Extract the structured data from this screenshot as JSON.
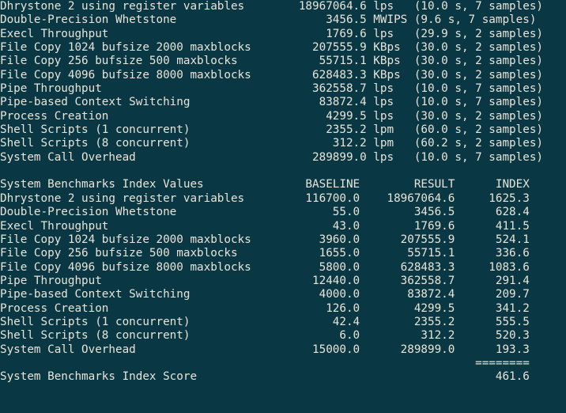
{
  "terminal": {
    "background_color": "#0a3744",
    "foreground_color": "#e8e4d8",
    "columns": 79,
    "rows": 30
  },
  "results": {
    "section_name": "benchmark-results",
    "rows": [
      {
        "name": "Dhrystone 2 using register variables",
        "value": "18967064.6",
        "unit": "lps",
        "timing": "(10.0 s, 7 samples)"
      },
      {
        "name": "Double-Precision Whetstone",
        "value": "3456.5",
        "unit": "MWIPS",
        "timing": "(9.6 s, 7 samples)"
      },
      {
        "name": "Execl Throughput",
        "value": "1769.6",
        "unit": "lps",
        "timing": "(29.9 s, 2 samples)"
      },
      {
        "name": "File Copy 1024 bufsize 2000 maxblocks",
        "value": "207555.9",
        "unit": "KBps",
        "timing": "(30.0 s, 2 samples)"
      },
      {
        "name": "File Copy 256 bufsize 500 maxblocks",
        "value": "55715.1",
        "unit": "KBps",
        "timing": "(30.0 s, 2 samples)"
      },
      {
        "name": "File Copy 4096 bufsize 8000 maxblocks",
        "value": "628483.3",
        "unit": "KBps",
        "timing": "(30.0 s, 2 samples)"
      },
      {
        "name": "Pipe Throughput",
        "value": "362558.7",
        "unit": "lps",
        "timing": "(10.0 s, 7 samples)"
      },
      {
        "name": "Pipe-based Context Switching",
        "value": "83872.4",
        "unit": "lps",
        "timing": "(10.0 s, 7 samples)"
      },
      {
        "name": "Process Creation",
        "value": "4299.5",
        "unit": "lps",
        "timing": "(30.0 s, 2 samples)"
      },
      {
        "name": "Shell Scripts (1 concurrent)",
        "value": "2355.2",
        "unit": "lpm",
        "timing": "(60.0 s, 2 samples)"
      },
      {
        "name": "Shell Scripts (8 concurrent)",
        "value": "312.2",
        "unit": "lpm",
        "timing": "(60.2 s, 2 samples)"
      },
      {
        "name": "System Call Overhead",
        "value": "289899.0",
        "unit": "lps",
        "timing": "(10.0 s, 7 samples)"
      }
    ]
  },
  "index_table": {
    "section_name": "system-benchmarks-index-values",
    "title": "System Benchmarks Index Values",
    "headers": {
      "baseline": "BASELINE",
      "result": "RESULT",
      "index": "INDEX"
    },
    "rows": [
      {
        "name": "Dhrystone 2 using register variables",
        "baseline": "116700.0",
        "result": "18967064.6",
        "index": "1625.3"
      },
      {
        "name": "Double-Precision Whetstone",
        "baseline": "55.0",
        "result": "3456.5",
        "index": "628.4"
      },
      {
        "name": "Execl Throughput",
        "baseline": "43.0",
        "result": "1769.6",
        "index": "411.5"
      },
      {
        "name": "File Copy 1024 bufsize 2000 maxblocks",
        "baseline": "3960.0",
        "result": "207555.9",
        "index": "524.1"
      },
      {
        "name": "File Copy 256 bufsize 500 maxblocks",
        "baseline": "1655.0",
        "result": "55715.1",
        "index": "336.6"
      },
      {
        "name": "File Copy 4096 bufsize 8000 maxblocks",
        "baseline": "5800.0",
        "result": "628483.3",
        "index": "1083.6"
      },
      {
        "name": "Pipe Throughput",
        "baseline": "12440.0",
        "result": "362558.7",
        "index": "291.4"
      },
      {
        "name": "Pipe-based Context Switching",
        "baseline": "4000.0",
        "result": "83872.4",
        "index": "209.7"
      },
      {
        "name": "Process Creation",
        "baseline": "126.0",
        "result": "4299.5",
        "index": "341.2"
      },
      {
        "name": "Shell Scripts (1 concurrent)",
        "baseline": "42.4",
        "result": "2355.2",
        "index": "555.5"
      },
      {
        "name": "Shell Scripts (8 concurrent)",
        "baseline": "6.0",
        "result": "312.2",
        "index": "520.3"
      },
      {
        "name": "System Call Overhead",
        "baseline": "15000.0",
        "result": "289899.0",
        "index": "193.3"
      }
    ],
    "separator": "========",
    "score_label": "System Benchmarks Index Score",
    "score_value": "461.6"
  }
}
